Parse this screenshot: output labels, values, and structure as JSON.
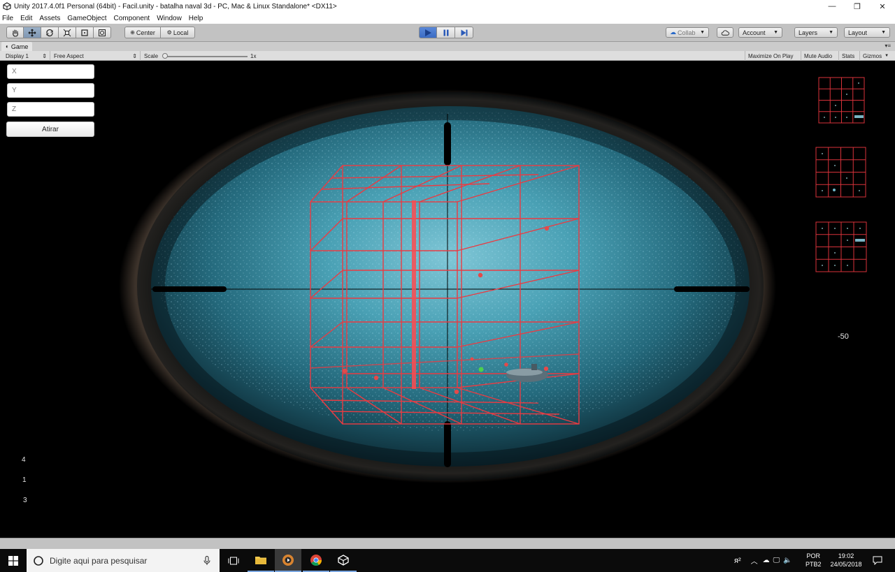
{
  "window": {
    "title": "Unity 2017.4.0f1 Personal (64bit) - Facil.unity - batalha naval 3d - PC, Mac & Linux Standalone* <DX11>",
    "controls": {
      "minimize": "—",
      "restore": "❐",
      "close": "✕"
    }
  },
  "menu": {
    "items": [
      "File",
      "Edit",
      "Assets",
      "GameObject",
      "Component",
      "Window",
      "Help"
    ]
  },
  "toolbar": {
    "pivot_center": "Center",
    "pivot_local": "Local",
    "collab": "Collab",
    "account": "Account",
    "layers": "Layers",
    "layout": "Layout"
  },
  "tab": {
    "label": "Game"
  },
  "game_bar": {
    "display": "Display 1",
    "aspect": "Free Aspect",
    "scale_label": "Scale",
    "scale_value": "1x",
    "maximize": "Maximize On Play",
    "mute": "Mute Audio",
    "stats": "Stats",
    "gizmos": "Gizmos"
  },
  "game_ui": {
    "x_placeholder": "X",
    "y_placeholder": "Y",
    "z_placeholder": "Z",
    "fire_label": "Atirar",
    "counters": [
      "4",
      "1",
      "3"
    ],
    "depth_readout": "-50"
  },
  "taskbar": {
    "search_placeholder": "Digite aqui para pesquisar",
    "lang_top": "POR",
    "lang_bottom": "PTB2",
    "time": "19:02",
    "date": "24/05/2018"
  },
  "colors": {
    "grid": "#e8383e",
    "water": "#3aa7c0",
    "accent": "#3b6cc4"
  }
}
